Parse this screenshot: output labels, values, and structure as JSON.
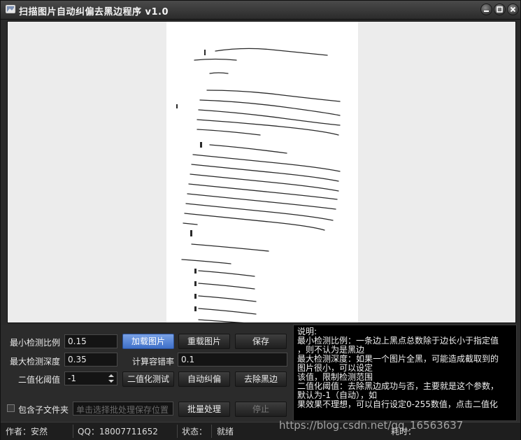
{
  "window": {
    "title": "扫描图片自动纠偏去黑边程序 v1.0"
  },
  "controls": {
    "min_ratio_label": "最小检测比例",
    "min_ratio_value": "0.15",
    "max_depth_label": "最大检测深度",
    "max_depth_value": "0.35",
    "threshold_label": "二值化阈值",
    "threshold_value": "-1",
    "tolerance_label": "计算容错率",
    "tolerance_value": "0.1",
    "include_subfolders_label": "包含子文件夹",
    "batch_path_placeholder": "单击选择批处理保存位置"
  },
  "buttons": {
    "load": "加载图片",
    "reload": "重载图片",
    "save": "保存",
    "binarize_test": "二值化测试",
    "auto_deskew": "自动纠偏",
    "remove_border": "去除黑边",
    "batch": "批量处理",
    "stop": "停止"
  },
  "help": {
    "lines": [
      "说明:",
      "最小检测比例：一条边上黑点总数除于边长小于指定值",
      "，则不认为是黑边",
      "最大检测深度：如果一个图片全黑，可能造成截取到的",
      "图片很小，可以设定",
      "该值，限制检测范围",
      "二值化阈值：去除黑边成功与否，主要就是这个参数，",
      "默认为-1（自动），如",
      "果效果不理想，可以自行设定0-255数值，点击二值化"
    ]
  },
  "statusbar": {
    "author": "作者：安然",
    "qq": "QQ：18007711652",
    "status_label": "状态：",
    "status_value": "就绪",
    "time_label": "耗时："
  },
  "watermark": "https://blog.csdn.net/qq_16563637"
}
